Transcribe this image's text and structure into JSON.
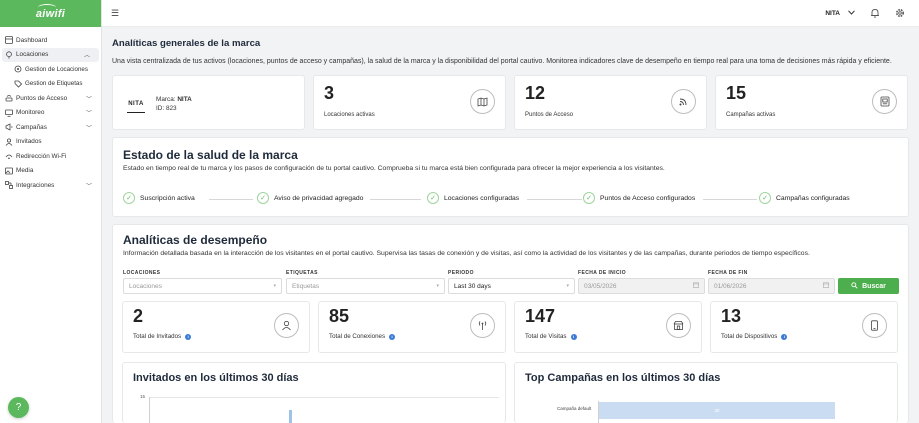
{
  "brand": {
    "logo_text": "aiwifi",
    "accent": "#5cb85c"
  },
  "sidebar": {
    "items": [
      {
        "label": "Dashboard",
        "icon": "dashboard-icon"
      },
      {
        "label": "Locaciones",
        "icon": "location-icon",
        "expanded": true,
        "children": [
          {
            "label": "Gestion de Locaciones",
            "icon": "location-pin-icon"
          },
          {
            "label": "Gestion de Etiquetas",
            "icon": "tag-icon"
          }
        ]
      },
      {
        "label": "Puntos de Acceso",
        "icon": "access-point-icon"
      },
      {
        "label": "Monitoreo",
        "icon": "monitor-icon"
      },
      {
        "label": "Campañas",
        "icon": "campaign-icon"
      },
      {
        "label": "Invitados",
        "icon": "guests-icon"
      },
      {
        "label": "Redirección Wi-Fi",
        "icon": "redirect-icon"
      },
      {
        "label": "Media",
        "icon": "media-icon"
      },
      {
        "label": "Integraciones",
        "icon": "integrations-icon"
      }
    ]
  },
  "topbar": {
    "brand_selector": "NITA"
  },
  "overview": {
    "title": "Analíticas generales de la marca",
    "description": "Una vista centralizada de tus activos (locaciones, puntos de acceso y campañas), la salud de la marca y la disponibilidad del portal cautivo. Monitorea indicadores clave de desempeño en tiempo real para una toma de decisiones más rápida y eficiente.",
    "brand_card": {
      "logo_text": "NITA",
      "brand_label": "Marca:",
      "brand_name": "NITA",
      "id_text": "ID: 823"
    },
    "stats": [
      {
        "value": "3",
        "label": "Locaciones activas",
        "icon": "map-icon"
      },
      {
        "value": "12",
        "label": "Puntos de Acceso",
        "icon": "wifi-signal-icon"
      },
      {
        "value": "15",
        "label": "Campañas activas",
        "icon": "campaign-board-icon"
      }
    ]
  },
  "health": {
    "title": "Estado de la salud de la marca",
    "description": "Estado en tiempo real de tu marca y los pasos de configuración de tu portal cautivo. Comprueba si tu marca está bien configurada para ofrecer la mejor experiencia a los visitantes.",
    "steps": [
      "Suscripción activa",
      "Aviso de privacidad agregado",
      "Locaciones configuradas",
      "Puntos de Acceso configurados",
      "Campañas configuradas"
    ]
  },
  "performance": {
    "title": "Analíticas de desempeño",
    "description": "Información detallada basada en la interacción de los visitantes en el portal cautivo. Supervisa las tasas de conexión y de visitas, así como la actividad de los visitantes y de las campañas, durante periodos de tiempo específicos.",
    "filters": {
      "locaciones": {
        "label": "LOCACIONES",
        "placeholder": "Locaciones"
      },
      "etiquetas": {
        "label": "ETIQUETAS",
        "placeholder": "Etiquetas"
      },
      "periodo": {
        "label": "PERIODO",
        "value": "Last 30 days"
      },
      "fecha_inicio": {
        "label": "FECHA DE INICIO",
        "value": "03/05/2026"
      },
      "fecha_fin": {
        "label": "FECHA DE FIN",
        "value": "01/06/2026"
      }
    },
    "search_button": "Buscar",
    "kpis": [
      {
        "value": "2",
        "label": "Total de Invitados",
        "icon": "guest-person-icon"
      },
      {
        "value": "85",
        "label": "Total de Conexiones",
        "icon": "antenna-icon"
      },
      {
        "value": "147",
        "label": "Total de Visitas",
        "icon": "store-icon"
      },
      {
        "value": "13",
        "label": "Total de Dispositivos",
        "icon": "device-icon"
      }
    ],
    "chart_left": {
      "title": "Invitados en los últimos 30 días",
      "y_tick": "15"
    },
    "chart_right": {
      "title": "Top Campañas en los últimos 30 días",
      "category": "Campaña default",
      "value_label": "30"
    }
  },
  "help_button": "?"
}
